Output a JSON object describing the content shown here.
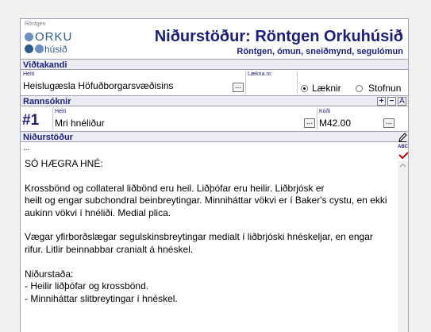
{
  "header": {
    "logo_small": "Röntgen",
    "logo_orku": "ORKU",
    "logo_husid": "húsið",
    "title": "Niðurstöður: Röntgen Orkuhúsið",
    "subtitle": "Röntgen, ómun, sneiðmynd, segulómun"
  },
  "vidtakandi": {
    "section_label": "Viðtakandi",
    "name_label": "Heiti",
    "name_value": "Heislugæsla Höfuðborgarsvæðisins",
    "ellipsis": "...",
    "laekna_label": "Lækna.nr.",
    "laekna_value": "",
    "radio_laeknir": "Læknir",
    "radio_stofnun": "Stofnun",
    "selected": "Læknir"
  },
  "rannsoknir": {
    "section_label": "Rannsóknir",
    "add_btn": "+",
    "remove_btn": "−",
    "font_btn": "A",
    "number": "#1",
    "name_label": "Heiti",
    "name_value": "Mri hnéliður",
    "code_label": "Kóði",
    "code_value": "M42.00",
    "ellipsis": "..."
  },
  "nidurstodur": {
    "section_label": "Niðurstöður",
    "top_line": "...",
    "paragraphs": [
      [
        "SÓ HÆGRA HNÉ:"
      ],
      [
        "Krossbönd og collateral liðbönd eru heil. Liðþófar eru heilir. Liðbrjósk er",
        "heilt og engar subchondral beinbreytingar. Minniháttar vökvi er í Baker's cystu, en ekki",
        "aukinn vökvi í hnéliði. Medial plica."
      ],
      [
        "Vægar yfirborðslægar segulskinsbreytingar medialt í liðbrjóski hnéskeljar, en engar",
        "rifur. Litlir beinnabbar cranialt á hnéskel."
      ],
      [
        "Niðurstaða:",
        "- Heilir liðþófar og krossbönd.",
        "- Minniháttar slitbreytingar í hnéskel."
      ]
    ],
    "spell_label": "ABC"
  },
  "colors": {
    "accent": "#1b1f7a",
    "logo_dot_a": "#6b8fc0",
    "logo_dot_b": "#2e5c8a"
  }
}
